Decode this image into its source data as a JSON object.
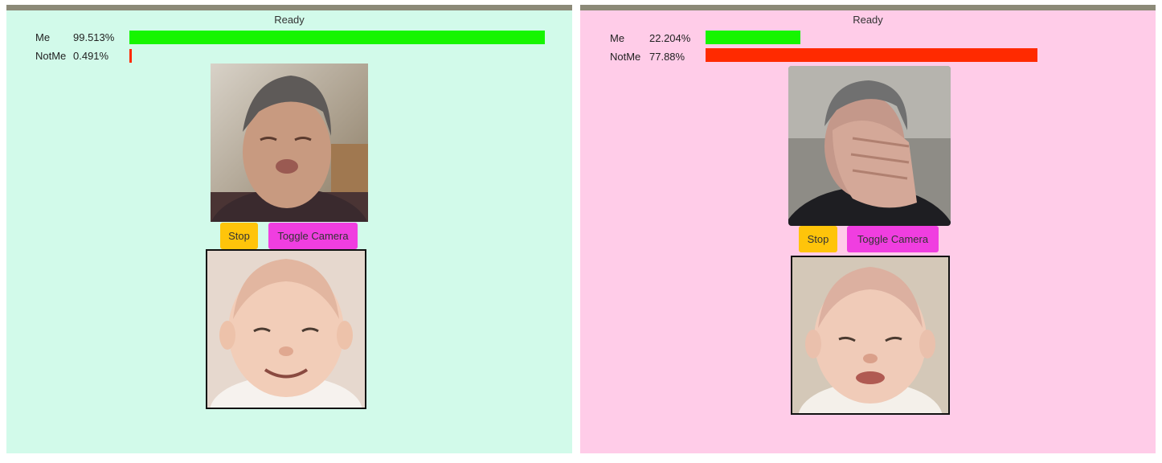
{
  "panels": [
    {
      "status": "Ready",
      "rows": [
        {
          "label": "Me",
          "value": "99.513%",
          "fraction": 0.99513,
          "color": "#16f500"
        },
        {
          "label": "NotMe",
          "value": "0.491%",
          "fraction": 0.00491,
          "color": "#ff2a00"
        }
      ],
      "buttons": {
        "stop": "Stop",
        "toggle": "Toggle Camera"
      },
      "background": "#d2faea"
    },
    {
      "status": "Ready",
      "rows": [
        {
          "label": "Me",
          "value": "22.204%",
          "fraction": 0.22204,
          "color": "#16f500"
        },
        {
          "label": "NotMe",
          "value": "77.88%",
          "fraction": 0.7788,
          "color": "#ff2a00"
        }
      ],
      "buttons": {
        "stop": "Stop",
        "toggle": "Toggle Camera"
      },
      "background": "#ffcce8"
    }
  ],
  "icons": {
    "camera_feed": "person-photo",
    "generated_face": "baby-face"
  }
}
